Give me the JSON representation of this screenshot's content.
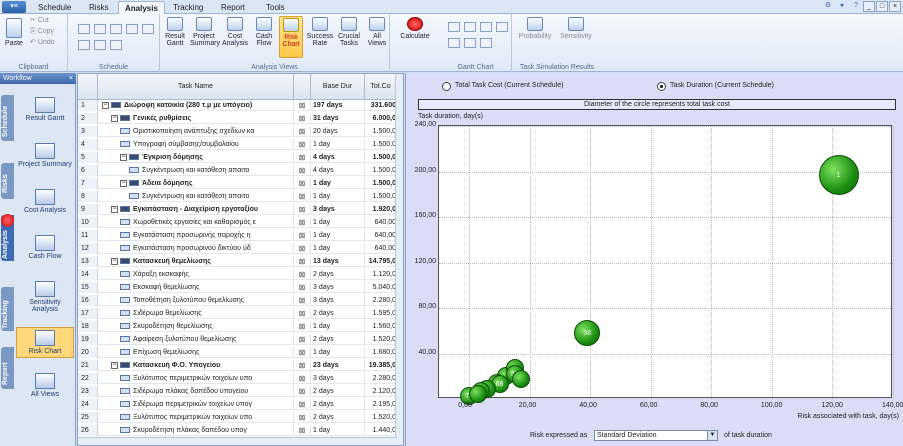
{
  "menu": {
    "tabs": [
      "Schedule",
      "Risks",
      "Analysis",
      "Tracking",
      "Report",
      "Tools"
    ],
    "active_tab": "Analysis"
  },
  "ribbon": {
    "clipboard": {
      "label": "Clipboard",
      "paste": "Paste",
      "cut": "Cut",
      "copy": "Copy",
      "undo": "Undo"
    },
    "schedule": {
      "label": "Schedule"
    },
    "analysis_views": {
      "label": "Analysis Views",
      "buttons": [
        {
          "line1": "Result",
          "line2": "Gantt"
        },
        {
          "line1": "Project",
          "line2": "Summary"
        },
        {
          "line1": "Cost",
          "line2": "Analysis"
        },
        {
          "line1": "Cash",
          "line2": "Flow"
        },
        {
          "line1": "Risk",
          "line2": "Chart"
        },
        {
          "line1": "Success",
          "line2": "Rate"
        },
        {
          "line1": "Crucial",
          "line2": "Tasks"
        }
      ],
      "all_views": {
        "line1": "All",
        "line2": "Views"
      }
    },
    "calculate": "Calculate",
    "gantt_chart": {
      "label": "Gantt Chart"
    },
    "simulation": {
      "label": "Task Simulation Results",
      "prob": "Probability",
      "sens": "Sensitivity"
    }
  },
  "workflow": {
    "title": "Workflow",
    "tabs": [
      "Schedule",
      "Risks",
      "Analysis",
      "Tracking",
      "Report"
    ],
    "items": [
      {
        "label": "Result Gantt"
      },
      {
        "label": "Project Summary"
      },
      {
        "label": "Cost Analysis"
      },
      {
        "label": "Cash Flow"
      },
      {
        "label": "Sensitivity Analysis"
      },
      {
        "label": "Risk Chart"
      },
      {
        "label": "All Views"
      }
    ]
  },
  "grid": {
    "headers": {
      "name": "Task Name",
      "dur": "Base Dur",
      "cost": "Tot.Co"
    },
    "rows": [
      {
        "n": "1",
        "name": "Διώροφη κατοικία (280 τ.μ με υπόγειο)",
        "dur": "197 days",
        "cost": "331.600",
        "level": 0,
        "sum": true
      },
      {
        "n": "2",
        "name": "Γενικές ρυθμίσεις",
        "dur": "31 days",
        "cost": "6.000,0",
        "level": 1,
        "sum": true
      },
      {
        "n": "3",
        "name": "Οριστικοποίηση ανάπτυξης σχεδίων κα",
        "dur": "20 days",
        "cost": "1.500,0",
        "level": 2,
        "sum": false
      },
      {
        "n": "4",
        "name": "Υπογραφή σύμβασης/συμβολαίου",
        "dur": "1 day",
        "cost": "1.500,0",
        "level": 2,
        "sum": false
      },
      {
        "n": "5",
        "name": "Έγκριση δόμησης",
        "dur": "4 days",
        "cost": "1.500,0",
        "level": 2,
        "sum": true
      },
      {
        "n": "6",
        "name": "Συγκέντρωση και κατάθεση απαιτο",
        "dur": "4 days",
        "cost": "1.500,0",
        "level": 3,
        "sum": false
      },
      {
        "n": "7",
        "name": "Άδεια δόμησης",
        "dur": "1 day",
        "cost": "1.500,0",
        "level": 2,
        "sum": true
      },
      {
        "n": "8",
        "name": "Συγκέντρωση και κατάθεση απαιτο",
        "dur": "1 day",
        "cost": "1.500,0",
        "level": 3,
        "sum": false
      },
      {
        "n": "9",
        "name": "Εγκατάσταση - Διαχείριση εργοταξίου",
        "dur": "3 days",
        "cost": "1.920,0",
        "level": 1,
        "sum": true
      },
      {
        "n": "10",
        "name": "Χωροθετικές εργασίες και καθαρισμός ε",
        "dur": "1 day",
        "cost": "640,00",
        "level": 2,
        "sum": false
      },
      {
        "n": "11",
        "name": "Εγκατάσταση προσωρινής παροχής η",
        "dur": "1 day",
        "cost": "640,00",
        "level": 2,
        "sum": false
      },
      {
        "n": "12",
        "name": "Εγκατάσταση προσωρινού δικτύου ύδ",
        "dur": "1 day",
        "cost": "640,00",
        "level": 2,
        "sum": false
      },
      {
        "n": "13",
        "name": "Κατασκευή θεμελίωσης",
        "dur": "13 days",
        "cost": "14.795,0",
        "level": 1,
        "sum": true
      },
      {
        "n": "14",
        "name": "Χάραξη εκσκαφής",
        "dur": "2 days",
        "cost": "1.120,0",
        "level": 2,
        "sum": false
      },
      {
        "n": "15",
        "name": "Εκσκαφή θεμελίωσης",
        "dur": "3 days",
        "cost": "5.040,0",
        "level": 2,
        "sum": false
      },
      {
        "n": "16",
        "name": "Τοποθέτηση ξυλοτύπου θεμελίωσης",
        "dur": "3 days",
        "cost": "2.280,0",
        "level": 2,
        "sum": false
      },
      {
        "n": "17",
        "name": "Σιδέρωμα θεμελίωσης",
        "dur": "2 days",
        "cost": "1.595,0",
        "level": 2,
        "sum": false
      },
      {
        "n": "18",
        "name": "Σκυροδέτηση θεμελίωσης",
        "dur": "1 day",
        "cost": "1.560,0",
        "level": 2,
        "sum": false
      },
      {
        "n": "19",
        "name": "Αφαίρεση ξυλοτύπου θεμελίωσης",
        "dur": "2 days",
        "cost": "1.520,0",
        "level": 2,
        "sum": false
      },
      {
        "n": "20",
        "name": "Επίχωση θεμελίωσης",
        "dur": "1 day",
        "cost": "1.680,0",
        "level": 2,
        "sum": false
      },
      {
        "n": "21",
        "name": "Κατασκευή Φ.Ο. Υπογείου",
        "dur": "23 days",
        "cost": "19.385,0",
        "level": 1,
        "sum": true
      },
      {
        "n": "22",
        "name": "Ξυλότυπος περιμετρικών τοιχείων υπο",
        "dur": "3 days",
        "cost": "2.280,0",
        "level": 2,
        "sum": false
      },
      {
        "n": "23",
        "name": "Σιδέρωμα πλάκας δαπέδου υπογείου",
        "dur": "2 days",
        "cost": "2.120,0",
        "level": 2,
        "sum": false
      },
      {
        "n": "24",
        "name": "Σιδέρωμα περιμετρικών τοιχείων υπογ",
        "dur": "2 days",
        "cost": "2.195,0",
        "level": 2,
        "sum": false
      },
      {
        "n": "25",
        "name": "Ξυλότυπος περιμετρικών τοιχείων υπο",
        "dur": "2 days",
        "cost": "1.520,0",
        "level": 2,
        "sum": false
      },
      {
        "n": "26",
        "name": "Σκυροδέτηση πλάκας δαπέδου υπογ",
        "dur": "1 day",
        "cost": "1.440,0",
        "level": 2,
        "sum": false
      }
    ]
  },
  "chart": {
    "radio_cost": "Total Task Cost (Current Schedule)",
    "radio_duration": "Task Duration (Current Schedule)",
    "selected": "duration",
    "subtitle": "Diameter of the circle represents total task cost",
    "footer_left": "Risk expressed as",
    "footer_right": "of task duration",
    "select_value": "Standard Deviation"
  },
  "chart_data": {
    "type": "scatter",
    "subtitle": "Diameter of the circle represents total task cost",
    "xlabel": "Risk associated with task, day(s)",
    "ylabel": "Task duration, day(s)",
    "xlim": [
      -10,
      140
    ],
    "ylim": [
      0,
      240
    ],
    "xticks": [
      "0,00",
      "20,00",
      "40,00",
      "60,00",
      "80,00",
      "100,00",
      "120,00",
      "140,00"
    ],
    "yticks": [
      "240,00",
      "200,00",
      "160,00",
      "120,00",
      "80,00",
      "40,00"
    ],
    "grid": true,
    "points": [
      {
        "label": "1",
        "x": 122,
        "y": 197
      },
      {
        "label": "58",
        "x": 39,
        "y": 58
      },
      {
        "label": "",
        "x": 12,
        "y": 20
      },
      {
        "label": "",
        "x": 15,
        "y": 27
      },
      {
        "label": "51",
        "x": 15,
        "y": 22
      },
      {
        "label": "",
        "x": 17,
        "y": 18
      },
      {
        "label": "",
        "x": 9,
        "y": 14
      },
      {
        "label": "68",
        "x": 10,
        "y": 13
      },
      {
        "label": "",
        "x": 6,
        "y": 9
      },
      {
        "label": "",
        "x": 4,
        "y": 7
      },
      {
        "label": "72",
        "x": 0,
        "y": 3
      },
      {
        "label": "",
        "x": 3,
        "y": 4
      }
    ]
  }
}
